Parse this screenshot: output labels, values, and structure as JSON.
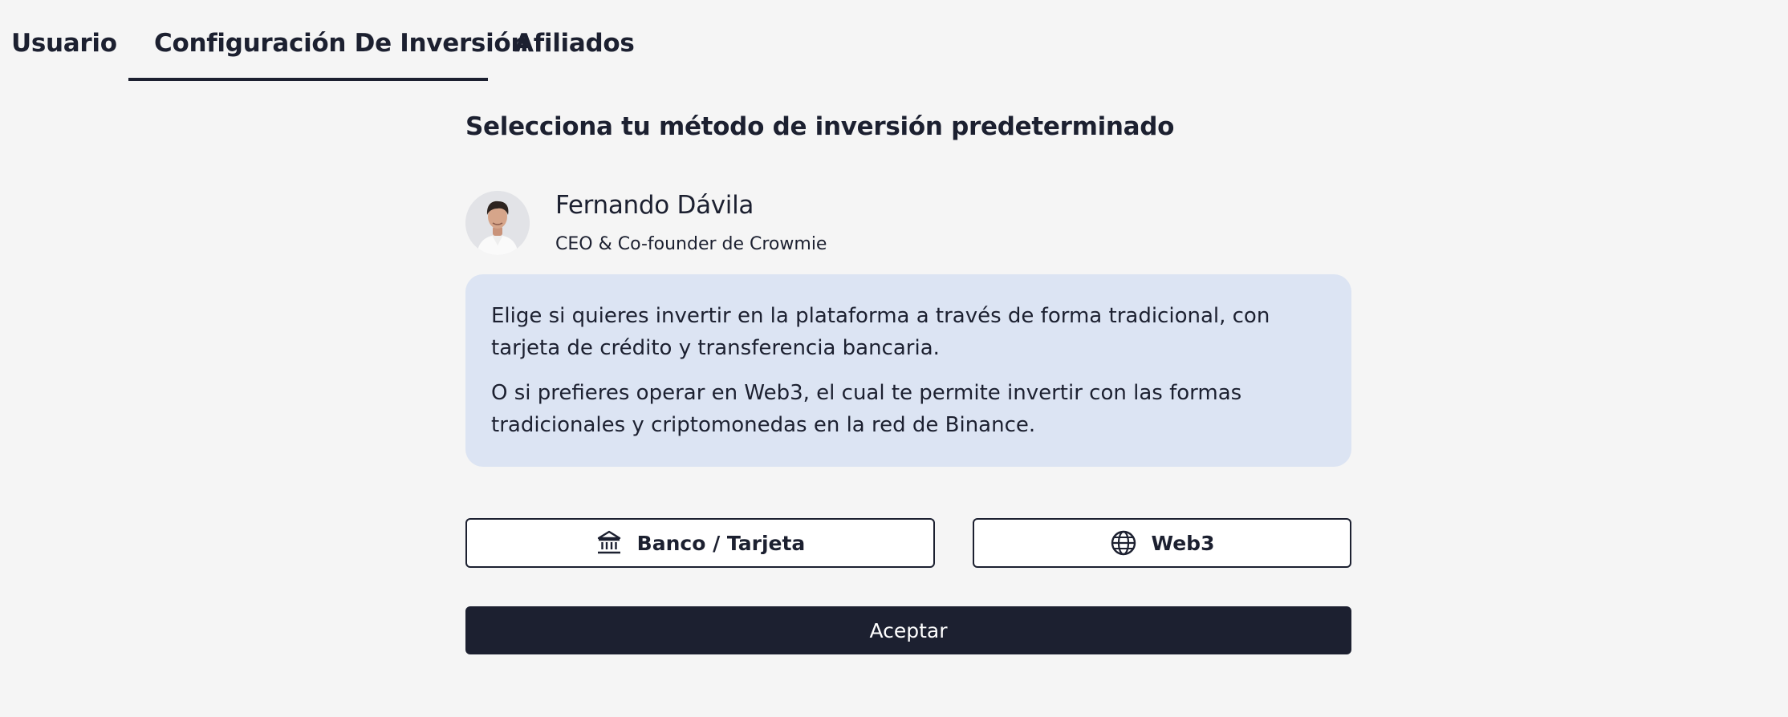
{
  "tabs": [
    {
      "label": "Usuario",
      "active": false
    },
    {
      "label": "Configuración De Inversión",
      "active": true
    },
    {
      "label": "Afiliados",
      "active": false
    }
  ],
  "page": {
    "title": "Selecciona tu método de inversión predeterminado"
  },
  "person": {
    "name": "Fernando Dávila",
    "role": "CEO & Co-founder de Crowmie"
  },
  "info": {
    "paragraph_1": "Elige si quieres invertir en la plataforma a través de forma tradicional, con tarjeta de crédito y transferencia bancaria.",
    "paragraph_2": "O si prefieres operar en Web3, el cual te permite invertir con las formas tradicionales y criptomonedas en la red de Binance."
  },
  "options": {
    "banco": {
      "label": "Banco / Tarjeta",
      "icon": "bank-icon"
    },
    "web3": {
      "label": "Web3",
      "icon": "globe-icon"
    }
  },
  "actions": {
    "accept_label": "Aceptar"
  },
  "colors": {
    "primary": "#1c2030",
    "info_background": "#dce4f3",
    "page_background": "#f5f5f5"
  }
}
